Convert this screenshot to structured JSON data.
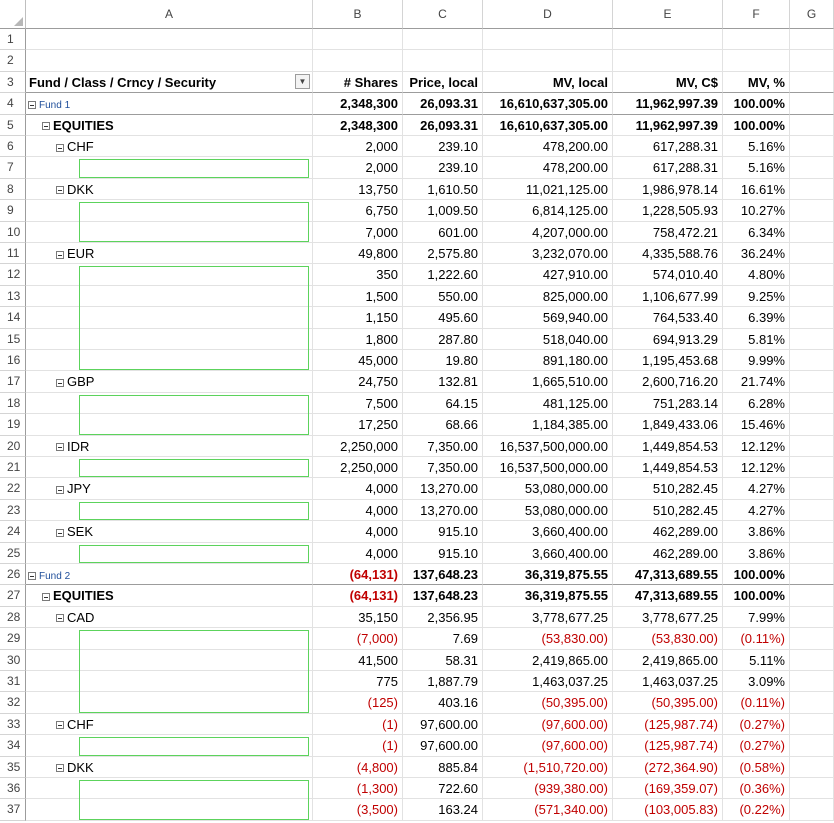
{
  "columns": [
    "A",
    "B",
    "C",
    "D",
    "E",
    "F",
    "G"
  ],
  "header": {
    "row": "3",
    "a": "Fund / Class / Crncy / Security",
    "b": "# Shares",
    "c": "Price, local",
    "d": "MV, local",
    "e": "MV, C$",
    "f": "MV, %"
  },
  "icons": {
    "dropdown": "filter-dropdown-icon",
    "collapse": "collapse-minus-icon"
  },
  "colors": {
    "negative": "#c00000",
    "selection_box": "#5cd35c",
    "fund_label": "#1f4e9a"
  },
  "rows": [
    {
      "n": "1",
      "level": "blank"
    },
    {
      "n": "2",
      "level": "blank"
    },
    {
      "n": "4",
      "level": "fund",
      "a": "Fund 1",
      "b": "2,348,300",
      "c": "26,093.31",
      "d": "16,610,637,305.00",
      "e": "11,962,997.39",
      "f": "100.00%"
    },
    {
      "n": "5",
      "level": "class",
      "a": "EQUITIES",
      "b": "2,348,300",
      "c": "26,093.31",
      "d": "16,610,637,305.00",
      "e": "11,962,997.39",
      "f": "100.00%"
    },
    {
      "n": "6",
      "level": "crncy",
      "a": "CHF",
      "b": "2,000",
      "c": "239.10",
      "d": "478,200.00",
      "e": "617,288.31",
      "f": "5.16%"
    },
    {
      "n": "7",
      "level": "sec",
      "a": "",
      "b": "2,000",
      "c": "239.10",
      "d": "478,200.00",
      "e": "617,288.31",
      "f": "5.16%"
    },
    {
      "n": "8",
      "level": "crncy",
      "a": "DKK",
      "b": "13,750",
      "c": "1,610.50",
      "d": "11,021,125.00",
      "e": "1,986,978.14",
      "f": "16.61%"
    },
    {
      "n": "9",
      "level": "sec",
      "a": "",
      "b": "6,750",
      "c": "1,009.50",
      "d": "6,814,125.00",
      "e": "1,228,505.93",
      "f": "10.27%"
    },
    {
      "n": "10",
      "level": "sec",
      "a": "",
      "b": "7,000",
      "c": "601.00",
      "d": "4,207,000.00",
      "e": "758,472.21",
      "f": "6.34%"
    },
    {
      "n": "11",
      "level": "crncy",
      "a": "EUR",
      "b": "49,800",
      "c": "2,575.80",
      "d": "3,232,070.00",
      "e": "4,335,588.76",
      "f": "36.24%"
    },
    {
      "n": "12",
      "level": "sec",
      "a": "",
      "b": "350",
      "c": "1,222.60",
      "d": "427,910.00",
      "e": "574,010.40",
      "f": "4.80%"
    },
    {
      "n": "13",
      "level": "sec",
      "a": "",
      "b": "1,500",
      "c": "550.00",
      "d": "825,000.00",
      "e": "1,106,677.99",
      "f": "9.25%"
    },
    {
      "n": "14",
      "level": "sec",
      "a": "",
      "b": "1,150",
      "c": "495.60",
      "d": "569,940.00",
      "e": "764,533.40",
      "f": "6.39%"
    },
    {
      "n": "15",
      "level": "sec",
      "a": "",
      "b": "1,800",
      "c": "287.80",
      "d": "518,040.00",
      "e": "694,913.29",
      "f": "5.81%"
    },
    {
      "n": "16",
      "level": "sec",
      "a": "",
      "b": "45,000",
      "c": "19.80",
      "d": "891,180.00",
      "e": "1,195,453.68",
      "f": "9.99%"
    },
    {
      "n": "17",
      "level": "crncy",
      "a": "GBP",
      "b": "24,750",
      "c": "132.81",
      "d": "1,665,510.00",
      "e": "2,600,716.20",
      "f": "21.74%"
    },
    {
      "n": "18",
      "level": "sec",
      "a": "",
      "b": "7,500",
      "c": "64.15",
      "d": "481,125.00",
      "e": "751,283.14",
      "f": "6.28%"
    },
    {
      "n": "19",
      "level": "sec",
      "a": "",
      "b": "17,250",
      "c": "68.66",
      "d": "1,184,385.00",
      "e": "1,849,433.06",
      "f": "15.46%"
    },
    {
      "n": "20",
      "level": "crncy",
      "a": "IDR",
      "b": "2,250,000",
      "c": "7,350.00",
      "d": "16,537,500,000.00",
      "e": "1,449,854.53",
      "f": "12.12%"
    },
    {
      "n": "21",
      "level": "sec",
      "a": "",
      "b": "2,250,000",
      "c": "7,350.00",
      "d": "16,537,500,000.00",
      "e": "1,449,854.53",
      "f": "12.12%"
    },
    {
      "n": "22",
      "level": "crncy",
      "a": "JPY",
      "b": "4,000",
      "c": "13,270.00",
      "d": "53,080,000.00",
      "e": "510,282.45",
      "f": "4.27%"
    },
    {
      "n": "23",
      "level": "sec",
      "a": "",
      "b": "4,000",
      "c": "13,270.00",
      "d": "53,080,000.00",
      "e": "510,282.45",
      "f": "4.27%"
    },
    {
      "n": "24",
      "level": "crncy",
      "a": "SEK",
      "b": "4,000",
      "c": "915.10",
      "d": "3,660,400.00",
      "e": "462,289.00",
      "f": "3.86%"
    },
    {
      "n": "25",
      "level": "sec",
      "a": "",
      "b": "4,000",
      "c": "915.10",
      "d": "3,660,400.00",
      "e": "462,289.00",
      "f": "3.86%"
    },
    {
      "n": "26",
      "level": "fund",
      "a": "Fund 2",
      "b": "(64,131)",
      "bneg": true,
      "c": "137,648.23",
      "d": "36,319,875.55",
      "e": "47,313,689.55",
      "f": "100.00%"
    },
    {
      "n": "27",
      "level": "class",
      "a": "EQUITIES",
      "b": "(64,131)",
      "bneg": true,
      "c": "137,648.23",
      "d": "36,319,875.55",
      "e": "47,313,689.55",
      "f": "100.00%"
    },
    {
      "n": "28",
      "level": "crncy",
      "a": "CAD",
      "b": "35,150",
      "c": "2,356.95",
      "d": "3,778,677.25",
      "e": "3,778,677.25",
      "f": "7.99%"
    },
    {
      "n": "29",
      "level": "sec",
      "a": "",
      "b": "(7,000)",
      "bneg": true,
      "c": "7.69",
      "d": "(53,830.00)",
      "dneg": true,
      "e": "(53,830.00)",
      "eneg": true,
      "f": "(0.11%)",
      "fneg": true
    },
    {
      "n": "30",
      "level": "sec",
      "a": "",
      "b": "41,500",
      "c": "58.31",
      "d": "2,419,865.00",
      "e": "2,419,865.00",
      "f": "5.11%"
    },
    {
      "n": "31",
      "level": "sec",
      "a": "",
      "b": "775",
      "c": "1,887.79",
      "d": "1,463,037.25",
      "e": "1,463,037.25",
      "f": "3.09%"
    },
    {
      "n": "32",
      "level": "sec",
      "a": "",
      "b": "(125)",
      "bneg": true,
      "c": "403.16",
      "d": "(50,395.00)",
      "dneg": true,
      "e": "(50,395.00)",
      "eneg": true,
      "f": "(0.11%)",
      "fneg": true
    },
    {
      "n": "33",
      "level": "crncy",
      "a": "CHF",
      "b": "(1)",
      "bneg": true,
      "c": "97,600.00",
      "d": "(97,600.00)",
      "dneg": true,
      "e": "(125,987.74)",
      "eneg": true,
      "f": "(0.27%)",
      "fneg": true
    },
    {
      "n": "34",
      "level": "sec",
      "a": "",
      "b": "(1)",
      "bneg": true,
      "c": "97,600.00",
      "d": "(97,600.00)",
      "dneg": true,
      "e": "(125,987.74)",
      "eneg": true,
      "f": "(0.27%)",
      "fneg": true
    },
    {
      "n": "35",
      "level": "crncy",
      "a": "DKK",
      "b": "(4,800)",
      "bneg": true,
      "c": "885.84",
      "d": "(1,510,720.00)",
      "dneg": true,
      "e": "(272,364.90)",
      "eneg": true,
      "f": "(0.58%)",
      "fneg": true
    },
    {
      "n": "36",
      "level": "sec",
      "a": "",
      "b": "(1,300)",
      "bneg": true,
      "c": "722.60",
      "d": "(939,380.00)",
      "dneg": true,
      "e": "(169,359.07)",
      "eneg": true,
      "f": "(0.36%)",
      "fneg": true
    },
    {
      "n": "37",
      "level": "sec",
      "a": "",
      "b": "(3,500)",
      "bneg": true,
      "c": "163.24",
      "d": "(571,340.00)",
      "dneg": true,
      "e": "(103,005.83)",
      "eneg": true,
      "f": "(0.22%)",
      "fneg": true
    }
  ]
}
